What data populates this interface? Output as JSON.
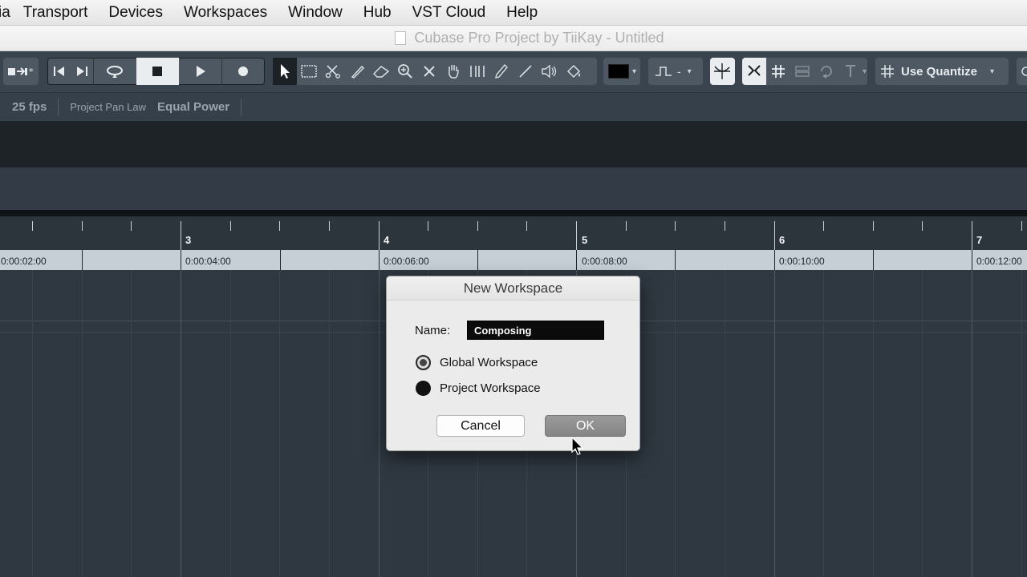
{
  "menubar": {
    "items": [
      "ia",
      "Transport",
      "Devices",
      "Workspaces",
      "Window",
      "Hub",
      "VST Cloud",
      "Help"
    ]
  },
  "window": {
    "title": "Cubase Pro Project by TiiKay - Untitled"
  },
  "toolbar": {
    "quantize_label": "Use Quantize",
    "tools": [
      "object-selection",
      "range-selection",
      "split",
      "glue",
      "erase",
      "zoom",
      "mute",
      "time-warp",
      "draw",
      "line",
      "play",
      "color"
    ]
  },
  "infoline": {
    "fps": "25 fps",
    "pan_law_label": "Project Pan Law",
    "pan_law_value": "Equal Power"
  },
  "ruler": {
    "bars": [
      "3",
      "4",
      "5",
      "6",
      "7"
    ],
    "times": [
      "0:00:02:00",
      "0:00:04:00",
      "0:00:06:00",
      "0:00:08:00",
      "0:00:10:00",
      "0:00:12:00"
    ]
  },
  "dialog": {
    "title": "New Workspace",
    "name_label": "Name:",
    "name_value": "Composing",
    "options": [
      "Global Workspace",
      "Project Workspace"
    ],
    "selected_option": "Global Workspace",
    "cancel_label": "Cancel",
    "ok_label": "OK"
  },
  "colors": {
    "project_bg": "#2f3841",
    "toolbar_bg": "#3a444e",
    "ruler_time_bg": "#c6cfd6",
    "dialog_bg": "#ebebeb",
    "ok_button": "#8f8f8f"
  }
}
